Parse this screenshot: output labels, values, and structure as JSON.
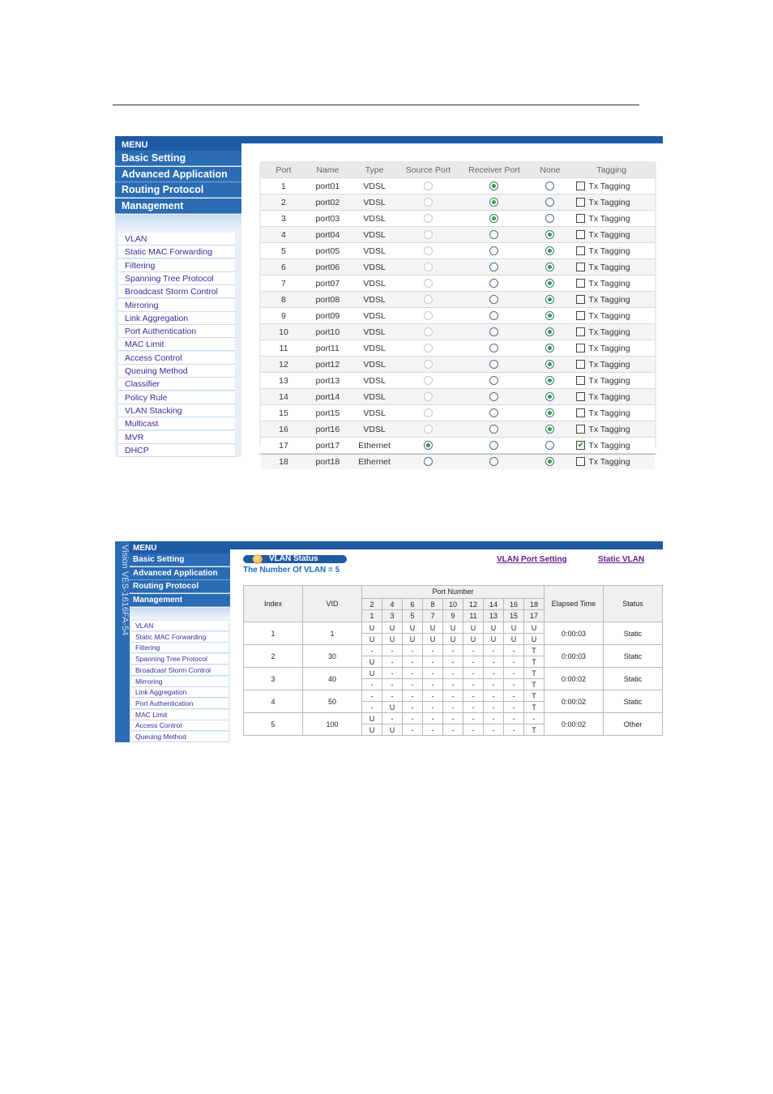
{
  "menu": {
    "title": "MENU",
    "main": [
      "Basic Setting",
      "Advanced Application",
      "Routing Protocol",
      "Management"
    ]
  },
  "screen1": {
    "submenu": [
      "VLAN",
      "Static MAC Forwarding",
      "Filtering",
      "Spanning Tree Protocol",
      "Broadcast Storm Control",
      "Mirroring",
      "Link Aggregation",
      "Port Authentication",
      "MAC Limit",
      "Access Control",
      "Queuing Method",
      "Classifier",
      "Policy Rule",
      "VLAN Stacking",
      "Multicast",
      "MVR",
      "DHCP"
    ],
    "columns": [
      "Port",
      "Name",
      "Type",
      "Source Port",
      "Receiver Port",
      "None",
      "Tagging"
    ],
    "tagging_label": "Tx Tagging",
    "rows": [
      {
        "port": "1",
        "name": "port01",
        "type": "VDSL",
        "selected": "receiver",
        "tagged": false,
        "source_enabled": false
      },
      {
        "port": "2",
        "name": "port02",
        "type": "VDSL",
        "selected": "receiver",
        "tagged": false,
        "source_enabled": false
      },
      {
        "port": "3",
        "name": "port03",
        "type": "VDSL",
        "selected": "receiver",
        "tagged": false,
        "source_enabled": false
      },
      {
        "port": "4",
        "name": "port04",
        "type": "VDSL",
        "selected": "none",
        "tagged": false,
        "source_enabled": false
      },
      {
        "port": "5",
        "name": "port05",
        "type": "VDSL",
        "selected": "none",
        "tagged": false,
        "source_enabled": false
      },
      {
        "port": "6",
        "name": "port06",
        "type": "VDSL",
        "selected": "none",
        "tagged": false,
        "source_enabled": false
      },
      {
        "port": "7",
        "name": "port07",
        "type": "VDSL",
        "selected": "none",
        "tagged": false,
        "source_enabled": false
      },
      {
        "port": "8",
        "name": "port08",
        "type": "VDSL",
        "selected": "none",
        "tagged": false,
        "source_enabled": false
      },
      {
        "port": "9",
        "name": "port09",
        "type": "VDSL",
        "selected": "none",
        "tagged": false,
        "source_enabled": false
      },
      {
        "port": "10",
        "name": "port10",
        "type": "VDSL",
        "selected": "none",
        "tagged": false,
        "source_enabled": false
      },
      {
        "port": "11",
        "name": "port11",
        "type": "VDSL",
        "selected": "none",
        "tagged": false,
        "source_enabled": false
      },
      {
        "port": "12",
        "name": "port12",
        "type": "VDSL",
        "selected": "none",
        "tagged": false,
        "source_enabled": false
      },
      {
        "port": "13",
        "name": "port13",
        "type": "VDSL",
        "selected": "none",
        "tagged": false,
        "source_enabled": false
      },
      {
        "port": "14",
        "name": "port14",
        "type": "VDSL",
        "selected": "none",
        "tagged": false,
        "source_enabled": false
      },
      {
        "port": "15",
        "name": "port15",
        "type": "VDSL",
        "selected": "none",
        "tagged": false,
        "source_enabled": false
      },
      {
        "port": "16",
        "name": "port16",
        "type": "VDSL",
        "selected": "none",
        "tagged": false,
        "source_enabled": false
      },
      {
        "port": "17",
        "name": "port17",
        "type": "Ethernet",
        "selected": "source",
        "tagged": true,
        "source_enabled": true
      },
      {
        "port": "18",
        "name": "port18",
        "type": "Ethernet",
        "selected": "none",
        "tagged": false,
        "source_enabled": true
      }
    ]
  },
  "screen2": {
    "vertical_brand": "Vision  VES-1616FA-54",
    "submenu": [
      "VLAN",
      "Static MAC Forwarding",
      "Filtering",
      "Spanning Tree Protocol",
      "Broadcast Storm Control",
      "Mirroring",
      "Link Aggregation",
      "Port Authentication",
      "MAC Limit",
      "Access Control",
      "Queuing Method"
    ],
    "title": "VLAN Status",
    "count_text": "The Number Of VLAN = 5",
    "links": [
      "VLAN Port Setting",
      "Static VLAN"
    ],
    "headers": {
      "index": "Index",
      "vid": "VID",
      "port_number": "Port Number",
      "elapsed": "Elapsed Time",
      "status": "Status"
    },
    "port_top": [
      "2",
      "4",
      "6",
      "8",
      "10",
      "12",
      "14",
      "16",
      "18"
    ],
    "port_bottom": [
      "1",
      "3",
      "5",
      "7",
      "9",
      "11",
      "13",
      "15",
      "17"
    ],
    "rows": [
      {
        "index": "1",
        "vid": "1",
        "top": [
          "U",
          "U",
          "U",
          "U",
          "U",
          "U",
          "U",
          "U",
          "U"
        ],
        "bottom": [
          "U",
          "U",
          "U",
          "U",
          "U",
          "U",
          "U",
          "U",
          "U"
        ],
        "elapsed": "0:00:03",
        "status": "Static"
      },
      {
        "index": "2",
        "vid": "30",
        "top": [
          "-",
          "-",
          "-",
          "-",
          "-",
          "-",
          "-",
          "-",
          "T"
        ],
        "bottom": [
          "U",
          "-",
          "-",
          "-",
          "-",
          "-",
          "-",
          "-",
          "T"
        ],
        "elapsed": "0:00:03",
        "status": "Static"
      },
      {
        "index": "3",
        "vid": "40",
        "top": [
          "U",
          "-",
          "-",
          "-",
          "-",
          "-",
          "-",
          "-",
          "T"
        ],
        "bottom": [
          "-",
          "-",
          "-",
          "-",
          "-",
          "-",
          "-",
          "-",
          "T"
        ],
        "elapsed": "0:00:02",
        "status": "Static"
      },
      {
        "index": "4",
        "vid": "50",
        "top": [
          "-",
          "-",
          "-",
          "-",
          "-",
          "-",
          "-",
          "-",
          "T"
        ],
        "bottom": [
          "-",
          "U",
          "-",
          "-",
          "-",
          "-",
          "-",
          "-",
          "T"
        ],
        "elapsed": "0:00:02",
        "status": "Static"
      },
      {
        "index": "5",
        "vid": "100",
        "top": [
          "U",
          "-",
          "-",
          "-",
          "-",
          "-",
          "-",
          "-",
          "-"
        ],
        "bottom": [
          "U",
          "U",
          "-",
          "-",
          "-",
          "-",
          "-",
          "-",
          "T"
        ],
        "elapsed": "0:00:02",
        "status": "Other"
      }
    ]
  }
}
